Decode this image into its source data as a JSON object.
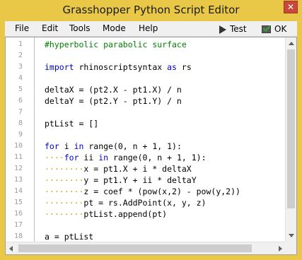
{
  "window": {
    "title": "Grasshopper Python Script Editor",
    "close_label": "✕"
  },
  "menu": {
    "items": [
      "File",
      "Edit",
      "Tools",
      "Mode",
      "Help"
    ],
    "test_label": "Test",
    "ok_label": "OK"
  },
  "editor": {
    "lines": [
      {
        "n": "1",
        "segments": [
          {
            "t": "#hyperbolic parabolic surface",
            "c": "cm"
          }
        ]
      },
      {
        "n": "2",
        "segments": []
      },
      {
        "n": "3",
        "segments": [
          {
            "t": "import",
            "c": "kw"
          },
          {
            "t": " rhinoscriptsyntax ",
            "c": ""
          },
          {
            "t": "as",
            "c": "kw"
          },
          {
            "t": " rs",
            "c": ""
          }
        ]
      },
      {
        "n": "4",
        "segments": []
      },
      {
        "n": "5",
        "segments": [
          {
            "t": "deltaX = (pt2.X - pt1.X) / n",
            "c": ""
          }
        ]
      },
      {
        "n": "6",
        "segments": [
          {
            "t": "deltaY = (pt2.Y - pt1.Y) / n",
            "c": ""
          }
        ]
      },
      {
        "n": "7",
        "segments": []
      },
      {
        "n": "8",
        "segments": [
          {
            "t": "ptList = []",
            "c": ""
          }
        ]
      },
      {
        "n": "9",
        "segments": []
      },
      {
        "n": "10",
        "segments": [
          {
            "t": "for",
            "c": "kw"
          },
          {
            "t": " i ",
            "c": ""
          },
          {
            "t": "in",
            "c": "kw"
          },
          {
            "t": " range(0, n + 1, 1):",
            "c": ""
          }
        ]
      },
      {
        "n": "11",
        "segments": [
          {
            "t": "····",
            "c": "ws"
          },
          {
            "t": "for",
            "c": "kw"
          },
          {
            "t": " ii ",
            "c": ""
          },
          {
            "t": "in",
            "c": "kw"
          },
          {
            "t": " range(0, n + 1, 1):",
            "c": ""
          }
        ]
      },
      {
        "n": "12",
        "segments": [
          {
            "t": "········",
            "c": "ws"
          },
          {
            "t": "x = pt1.X + i * deltaX",
            "c": ""
          }
        ]
      },
      {
        "n": "13",
        "segments": [
          {
            "t": "········",
            "c": "ws"
          },
          {
            "t": "y = pt1.Y + ii * deltaY",
            "c": ""
          }
        ]
      },
      {
        "n": "14",
        "segments": [
          {
            "t": "········",
            "c": "ws"
          },
          {
            "t": "z = coef * (pow(x,2) - pow(y,2))",
            "c": ""
          }
        ]
      },
      {
        "n": "15",
        "segments": [
          {
            "t": "········",
            "c": "ws"
          },
          {
            "t": "pt = rs.AddPoint(x, y, z)",
            "c": ""
          }
        ]
      },
      {
        "n": "16",
        "segments": [
          {
            "t": "········",
            "c": "ws"
          },
          {
            "t": "ptList.append(pt)",
            "c": ""
          }
        ]
      },
      {
        "n": "17",
        "segments": []
      },
      {
        "n": "18",
        "segments": [
          {
            "t": "a = ptList",
            "c": ""
          }
        ]
      }
    ]
  },
  "colors": {
    "frame": "#e8c846",
    "keyword": "#0000cc",
    "comment": "#008000",
    "whitespace_marker": "#c8a000",
    "line_number": "#9a9a9a"
  }
}
